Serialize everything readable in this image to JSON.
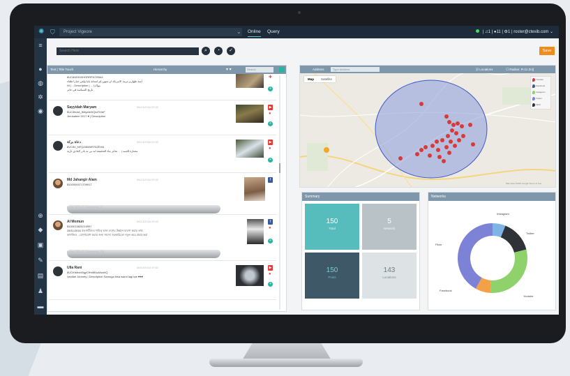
{
  "topbar": {
    "project": "Project Vigeore",
    "tabs": [
      "Online",
      "Query"
    ],
    "status": "| ♫1 | ●11 | ⚙1 |",
    "user": "roster@ctexib.com"
  },
  "search": {
    "placeholder": "Search Here",
    "save_label": "Save"
  },
  "feed": {
    "header_title": "Text | Title Touch",
    "header_mid": "Hierarchy",
    "search_placeholder": "Search",
    "posts": [
      {
        "name": "",
        "date": "",
        "lines": [
          "8UC8ASDIXHGRRFN7H5A4",
          "أمنة ظهارير تزينة الامريكة ان تنتهي لم استانة يلبا ولقي خيارا ظفاء",
          "Hi | ...Description | ... (مواك",
          "تاريخ السياسة في خابر"
        ],
        "foot": "",
        "source": "youtube"
      },
      {
        "name": "Sayyidah Maryam",
        "date": "08/13/2016 09:02",
        "lines": [
          "8UC9ihAA_5MyeAHIQtuTtXbF",
          "Jerusalem 2017 ♥ | Description"
        ],
        "foot": "",
        "source": "youtube"
      },
      {
        "name": "دعاة بركة",
        "date": "08/13/2016 09:02",
        "lines": [
          "8VC8V_NFQZI6WhR76ZEHA",
          "مختارة الجمد | ... تخابر ثناء التحقيقة انه بي نه يادر العادي ثارية"
        ],
        "foot": "",
        "source": "youtube"
      },
      {
        "name": "Md Jahangir Alam",
        "date": "08/13/2016 09:02",
        "lines": [
          "$100000071709917"
        ],
        "foot": "0 Like (47)  |  2 Comments (1)",
        "source": "facebook"
      },
      {
        "name": "Al Momun",
        "date": "08/13/2016 09:02",
        "lines": [
          "$100013820210997",
          "28/11/2016 ব্যবসায়ীদের দায়িত্ব ভাল দেশের উন্নয়ন ব্যবসা করার তথ্য",
          "কাগজিত - যোগাযোগ করার জন্য সমস্যা সরকারিতো নতুন করে প্রচার করা"
        ],
        "foot": "0 Like (32)  |  2 Comments (10)",
        "source": "facebook"
      },
      {
        "name": "Ulla Rani",
        "date": "08/13/2016 09:02",
        "lines": [
          "8UCKfsfrvnl9gyCfHnMAoMzsHQ",
          "Vanilari Journey | Description Samuga bisa warni lagi tae ♥♥♥"
        ],
        "foot": "",
        "source": "youtube"
      }
    ]
  },
  "map": {
    "address_label": "Address",
    "address_placeholder": "Type Address",
    "locations_label": "Locations",
    "radius_label": "Radius: R-11 Zn||",
    "tabs": [
      "Map",
      "Satellite"
    ],
    "legend": [
      "Youtube",
      "Facebook",
      "Instagram",
      "Twitter",
      "Flickr"
    ],
    "footer": "Map data ©2016 Google   Terms of Use"
  },
  "summary": {
    "title": "Summary",
    "tiles": [
      {
        "value": "150",
        "label": "Total"
      },
      {
        "value": "5",
        "label": "Network"
      },
      {
        "value": "150",
        "label": "Posts"
      },
      {
        "value": "143",
        "label": "Locations"
      }
    ]
  },
  "networks": {
    "title": "Networks",
    "chart_data": {
      "type": "pie",
      "categories": [
        "Instagram",
        "Twitter",
        "Youtube",
        "Facebook",
        "Flickr"
      ],
      "values": [
        6,
        15,
        30,
        7,
        42
      ],
      "colors": [
        "#7fb5e6",
        "#2f3338",
        "#8fd16a",
        "#f3a148",
        "#7c82d6"
      ]
    }
  }
}
